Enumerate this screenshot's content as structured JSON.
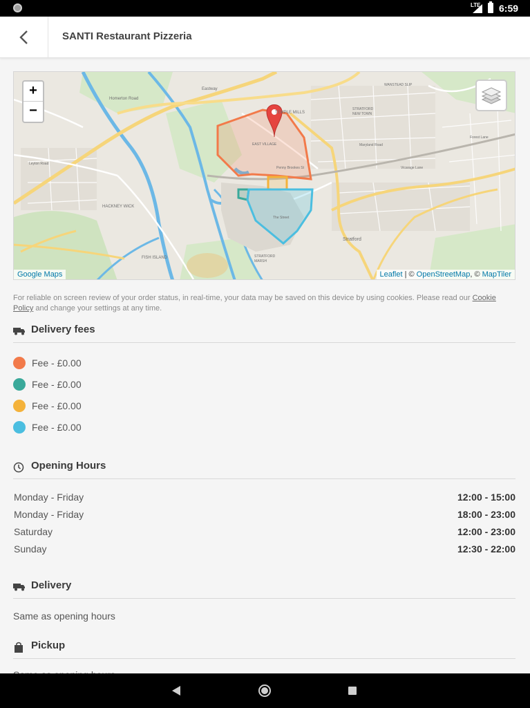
{
  "status_bar": {
    "time": "6:59",
    "network": "LTE"
  },
  "app_bar": {
    "title": "SANTI Restaurant Pizzeria"
  },
  "map": {
    "zoom_in": "+",
    "zoom_out": "−",
    "attribution_left": "Google Maps",
    "attribution_leaflet": "Leaflet",
    "attribution_sep1": " | © ",
    "attribution_osm": "OpenStreetMap",
    "attribution_sep2": ", © ",
    "attribution_maptiler": "MapTiler",
    "labels": {
      "homerton_road": "Homerton Road",
      "eastway": "Eastway",
      "temple_mills": "TEMPLE MILLS",
      "east_village": "EAST VILLAGE",
      "hackney_wick": "HACKNEY WICK",
      "fish_island": "FISH ISLAND",
      "stratford_new_town": "STRATFORD NEW TOWN",
      "stratford": "Stratford",
      "stratford_marsh": "STRATFORD MARSH",
      "wanstead_slip": "WANSTEAD SLIP",
      "penny_brookes": "Penny Brookes St",
      "the_street": "The Street",
      "forest_lane": "Forest Lane",
      "maryland_road": "Maryland Road",
      "vicarage_lane": "Vicarage Lane",
      "leyton_road": "Leyton Road"
    },
    "zone_colors": {
      "orange": "#f27a4a",
      "green": "#3aa99a",
      "yellow": "#f4b23a",
      "blue": "#4bbee0"
    },
    "pin_color": "#e5443f"
  },
  "cookie_notice": {
    "text_before": "For reliable on screen review of your order status, in real-time, your data may be saved on this device by using cookies. Please read our ",
    "link": "Cookie Policy",
    "text_after": " and change your settings at any time."
  },
  "delivery_fees": {
    "title": "Delivery fees",
    "items": [
      {
        "label": "Fee - £0.00",
        "color": "#f27a4a"
      },
      {
        "label": "Fee - £0.00",
        "color": "#3aa99a"
      },
      {
        "label": "Fee - £0.00",
        "color": "#f4b23a"
      },
      {
        "label": "Fee - £0.00",
        "color": "#4bbee0"
      }
    ]
  },
  "opening_hours": {
    "title": "Opening Hours",
    "rows": [
      {
        "day": "Monday - Friday",
        "time": "12:00 - 15:00"
      },
      {
        "day": "Monday - Friday",
        "time": "18:00 - 23:00"
      },
      {
        "day": "Saturday",
        "time": "12:00 - 23:00"
      },
      {
        "day": "Sunday",
        "time": "12:30 - 22:00"
      }
    ]
  },
  "delivery": {
    "title": "Delivery",
    "text": "Same as opening hours"
  },
  "pickup": {
    "title": "Pickup",
    "text": "Same as opening hours"
  }
}
